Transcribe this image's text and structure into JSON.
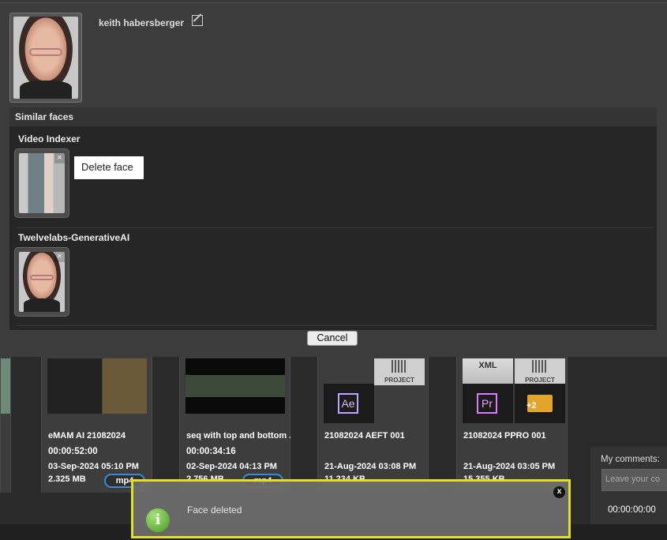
{
  "profile": {
    "name": "keith habersberger"
  },
  "similar": {
    "header": "Similar faces",
    "groups": [
      {
        "title": "Video Indexer"
      },
      {
        "title": "Twelvelabs-GenerativeAI"
      }
    ],
    "tooltip": "Delete face",
    "close_glyph": "×"
  },
  "buttons": {
    "cancel": "Cancel"
  },
  "assets": [
    {
      "name": "eMAM AI 21082024",
      "duration": "00:00:52:00",
      "date": "03-Sep-2024 05:10 PM",
      "size": "2.325 MB",
      "format": "mp4"
    },
    {
      "name": "seq with top and bottom ...",
      "duration": "00:00:34:16",
      "date": "02-Sep-2024 04:13 PM",
      "size": "2.756 MB",
      "format": "mp4"
    },
    {
      "name": "21082024 AEFT 001",
      "duration": "",
      "date": "21-Aug-2024 03:08 PM",
      "size": "11.234 KB",
      "format": ""
    },
    {
      "name": "21082024 PPRO 001",
      "duration": "",
      "date": "21-Aug-2024 03:05 PM",
      "size": "15.355 KB",
      "format": ""
    }
  ],
  "tiles": {
    "project": "PROJECT",
    "xml": "XML",
    "ae": "Ae",
    "pr": "Pr",
    "plus": "+2"
  },
  "comments": {
    "label": "My comments:",
    "placeholder": "Leave your co",
    "timecode": "00:00:00:00"
  },
  "toast": {
    "message": "Face deleted",
    "close": "x",
    "info_glyph": "i"
  },
  "colors": {
    "toast_border": "#e5e01e",
    "format_pill": "#3a8ad8",
    "info_icon": "#4a9a22"
  }
}
